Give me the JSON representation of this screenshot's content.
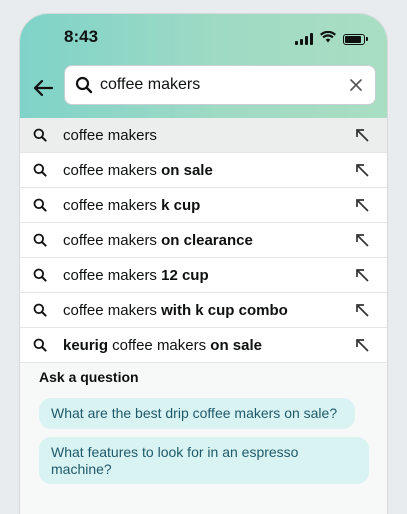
{
  "status_bar": {
    "time": "8:43"
  },
  "search": {
    "value": "coffee makers"
  },
  "suggestions": [
    {
      "prefix": "coffee makers",
      "suffix": ""
    },
    {
      "prefix": "coffee makers ",
      "suffix": "on sale"
    },
    {
      "prefix": "coffee makers ",
      "suffix": "k cup"
    },
    {
      "prefix": "coffee makers ",
      "suffix": "on clearance"
    },
    {
      "prefix": "coffee makers ",
      "suffix": "12 cup"
    },
    {
      "prefix": "coffee makers ",
      "suffix": "with k cup combo"
    },
    {
      "prefix_bold": "keurig",
      "middle": " coffee makers ",
      "suffix": "on sale"
    }
  ],
  "ask": {
    "title": "Ask a question",
    "questions": [
      "What are the best drip coffee makers on sale?",
      "What features to look for in an espresso machine?"
    ]
  },
  "icons": {
    "back": "arrow-left-icon",
    "search": "search-icon",
    "clear": "close-icon",
    "fill": "arrow-up-left-icon",
    "signal": "signal-icon",
    "wifi": "wifi-icon",
    "battery": "battery-icon"
  },
  "colors": {
    "header_gradient_start": "#7fd3c9",
    "header_gradient_end": "#a9dec2",
    "question_pill_bg": "#d9f3f3",
    "question_pill_text": "#1f5a6a"
  }
}
